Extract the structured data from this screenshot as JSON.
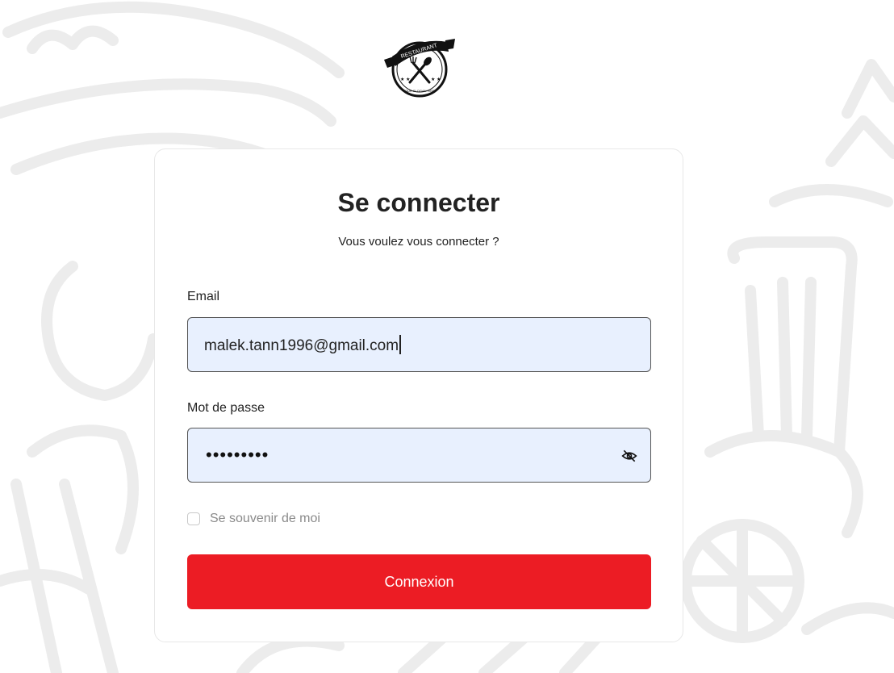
{
  "logo": {
    "banner_text": "RESTAURANT",
    "slogan_text": "YOUR SLOGAN HERE"
  },
  "login": {
    "title": "Se connecter",
    "subtitle": "Vous voulez vous connecter ?",
    "email_label": "Email",
    "email_value": "malek.tann1996@gmail.com",
    "password_label": "Mot de passe",
    "password_masked": "•••••••••",
    "remember_label": "Se souvenir de moi",
    "remember_checked": false,
    "submit_label": "Connexion"
  },
  "icons": {
    "password_toggle": "eye-off-icon",
    "logo_symbol": "fork-spoon-icon"
  },
  "colors": {
    "accent": "#ec1c24",
    "input_background": "#e8f0fe",
    "background_sketch": "#ececec"
  }
}
